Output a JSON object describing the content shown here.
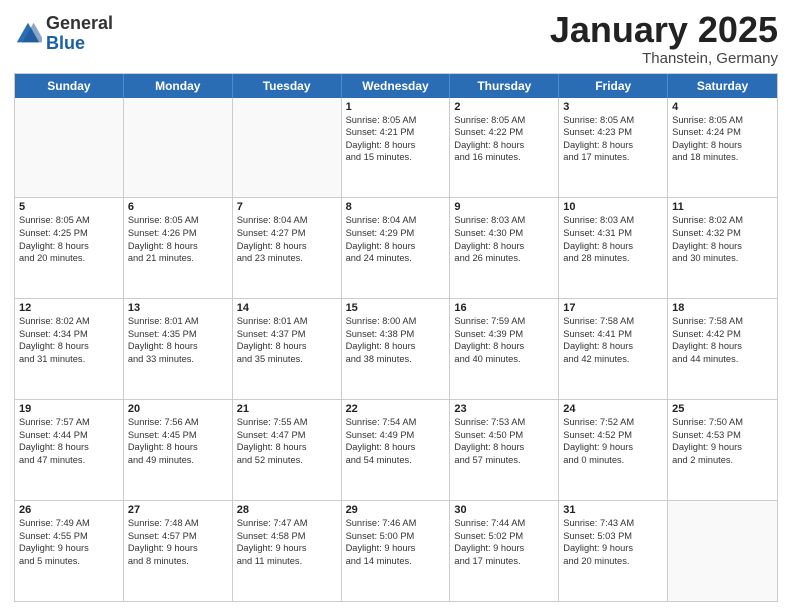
{
  "logo": {
    "general": "General",
    "blue": "Blue"
  },
  "header": {
    "title": "January 2025",
    "subtitle": "Thanstein, Germany"
  },
  "weekdays": [
    "Sunday",
    "Monday",
    "Tuesday",
    "Wednesday",
    "Thursday",
    "Friday",
    "Saturday"
  ],
  "weeks": [
    [
      {
        "day": "",
        "lines": [],
        "empty": true
      },
      {
        "day": "",
        "lines": [],
        "empty": true
      },
      {
        "day": "",
        "lines": [],
        "empty": true
      },
      {
        "day": "1",
        "lines": [
          "Sunrise: 8:05 AM",
          "Sunset: 4:21 PM",
          "Daylight: 8 hours",
          "and 15 minutes."
        ],
        "empty": false
      },
      {
        "day": "2",
        "lines": [
          "Sunrise: 8:05 AM",
          "Sunset: 4:22 PM",
          "Daylight: 8 hours",
          "and 16 minutes."
        ],
        "empty": false
      },
      {
        "day": "3",
        "lines": [
          "Sunrise: 8:05 AM",
          "Sunset: 4:23 PM",
          "Daylight: 8 hours",
          "and 17 minutes."
        ],
        "empty": false
      },
      {
        "day": "4",
        "lines": [
          "Sunrise: 8:05 AM",
          "Sunset: 4:24 PM",
          "Daylight: 8 hours",
          "and 18 minutes."
        ],
        "empty": false
      }
    ],
    [
      {
        "day": "5",
        "lines": [
          "Sunrise: 8:05 AM",
          "Sunset: 4:25 PM",
          "Daylight: 8 hours",
          "and 20 minutes."
        ],
        "empty": false
      },
      {
        "day": "6",
        "lines": [
          "Sunrise: 8:05 AM",
          "Sunset: 4:26 PM",
          "Daylight: 8 hours",
          "and 21 minutes."
        ],
        "empty": false
      },
      {
        "day": "7",
        "lines": [
          "Sunrise: 8:04 AM",
          "Sunset: 4:27 PM",
          "Daylight: 8 hours",
          "and 23 minutes."
        ],
        "empty": false
      },
      {
        "day": "8",
        "lines": [
          "Sunrise: 8:04 AM",
          "Sunset: 4:29 PM",
          "Daylight: 8 hours",
          "and 24 minutes."
        ],
        "empty": false
      },
      {
        "day": "9",
        "lines": [
          "Sunrise: 8:03 AM",
          "Sunset: 4:30 PM",
          "Daylight: 8 hours",
          "and 26 minutes."
        ],
        "empty": false
      },
      {
        "day": "10",
        "lines": [
          "Sunrise: 8:03 AM",
          "Sunset: 4:31 PM",
          "Daylight: 8 hours",
          "and 28 minutes."
        ],
        "empty": false
      },
      {
        "day": "11",
        "lines": [
          "Sunrise: 8:02 AM",
          "Sunset: 4:32 PM",
          "Daylight: 8 hours",
          "and 30 minutes."
        ],
        "empty": false
      }
    ],
    [
      {
        "day": "12",
        "lines": [
          "Sunrise: 8:02 AM",
          "Sunset: 4:34 PM",
          "Daylight: 8 hours",
          "and 31 minutes."
        ],
        "empty": false
      },
      {
        "day": "13",
        "lines": [
          "Sunrise: 8:01 AM",
          "Sunset: 4:35 PM",
          "Daylight: 8 hours",
          "and 33 minutes."
        ],
        "empty": false
      },
      {
        "day": "14",
        "lines": [
          "Sunrise: 8:01 AM",
          "Sunset: 4:37 PM",
          "Daylight: 8 hours",
          "and 35 minutes."
        ],
        "empty": false
      },
      {
        "day": "15",
        "lines": [
          "Sunrise: 8:00 AM",
          "Sunset: 4:38 PM",
          "Daylight: 8 hours",
          "and 38 minutes."
        ],
        "empty": false
      },
      {
        "day": "16",
        "lines": [
          "Sunrise: 7:59 AM",
          "Sunset: 4:39 PM",
          "Daylight: 8 hours",
          "and 40 minutes."
        ],
        "empty": false
      },
      {
        "day": "17",
        "lines": [
          "Sunrise: 7:58 AM",
          "Sunset: 4:41 PM",
          "Daylight: 8 hours",
          "and 42 minutes."
        ],
        "empty": false
      },
      {
        "day": "18",
        "lines": [
          "Sunrise: 7:58 AM",
          "Sunset: 4:42 PM",
          "Daylight: 8 hours",
          "and 44 minutes."
        ],
        "empty": false
      }
    ],
    [
      {
        "day": "19",
        "lines": [
          "Sunrise: 7:57 AM",
          "Sunset: 4:44 PM",
          "Daylight: 8 hours",
          "and 47 minutes."
        ],
        "empty": false
      },
      {
        "day": "20",
        "lines": [
          "Sunrise: 7:56 AM",
          "Sunset: 4:45 PM",
          "Daylight: 8 hours",
          "and 49 minutes."
        ],
        "empty": false
      },
      {
        "day": "21",
        "lines": [
          "Sunrise: 7:55 AM",
          "Sunset: 4:47 PM",
          "Daylight: 8 hours",
          "and 52 minutes."
        ],
        "empty": false
      },
      {
        "day": "22",
        "lines": [
          "Sunrise: 7:54 AM",
          "Sunset: 4:49 PM",
          "Daylight: 8 hours",
          "and 54 minutes."
        ],
        "empty": false
      },
      {
        "day": "23",
        "lines": [
          "Sunrise: 7:53 AM",
          "Sunset: 4:50 PM",
          "Daylight: 8 hours",
          "and 57 minutes."
        ],
        "empty": false
      },
      {
        "day": "24",
        "lines": [
          "Sunrise: 7:52 AM",
          "Sunset: 4:52 PM",
          "Daylight: 9 hours",
          "and 0 minutes."
        ],
        "empty": false
      },
      {
        "day": "25",
        "lines": [
          "Sunrise: 7:50 AM",
          "Sunset: 4:53 PM",
          "Daylight: 9 hours",
          "and 2 minutes."
        ],
        "empty": false
      }
    ],
    [
      {
        "day": "26",
        "lines": [
          "Sunrise: 7:49 AM",
          "Sunset: 4:55 PM",
          "Daylight: 9 hours",
          "and 5 minutes."
        ],
        "empty": false
      },
      {
        "day": "27",
        "lines": [
          "Sunrise: 7:48 AM",
          "Sunset: 4:57 PM",
          "Daylight: 9 hours",
          "and 8 minutes."
        ],
        "empty": false
      },
      {
        "day": "28",
        "lines": [
          "Sunrise: 7:47 AM",
          "Sunset: 4:58 PM",
          "Daylight: 9 hours",
          "and 11 minutes."
        ],
        "empty": false
      },
      {
        "day": "29",
        "lines": [
          "Sunrise: 7:46 AM",
          "Sunset: 5:00 PM",
          "Daylight: 9 hours",
          "and 14 minutes."
        ],
        "empty": false
      },
      {
        "day": "30",
        "lines": [
          "Sunrise: 7:44 AM",
          "Sunset: 5:02 PM",
          "Daylight: 9 hours",
          "and 17 minutes."
        ],
        "empty": false
      },
      {
        "day": "31",
        "lines": [
          "Sunrise: 7:43 AM",
          "Sunset: 5:03 PM",
          "Daylight: 9 hours",
          "and 20 minutes."
        ],
        "empty": false
      },
      {
        "day": "",
        "lines": [],
        "empty": true
      }
    ]
  ]
}
